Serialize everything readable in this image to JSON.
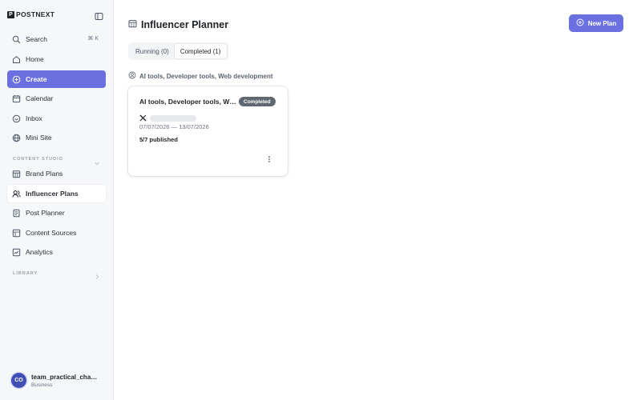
{
  "brand": {
    "mark": "P",
    "name": "POSTNEXT"
  },
  "sidebar": {
    "search": {
      "label": "Search",
      "shortcut": "⌘ K"
    },
    "main_items": [
      {
        "label": "Home",
        "icon": "home-icon"
      },
      {
        "label": "Create",
        "icon": "plus-circle-icon"
      },
      {
        "label": "Calendar",
        "icon": "calendar-icon"
      },
      {
        "label": "Inbox",
        "icon": "inbox-icon"
      },
      {
        "label": "Mini Site",
        "icon": "globe-icon"
      }
    ],
    "content_studio_label": "CONTENT STUDIO",
    "content_studio_items": [
      {
        "label": "Brand Plans",
        "icon": "calendar-grid-icon"
      },
      {
        "label": "Influencer Plans",
        "icon": "users-icon"
      },
      {
        "label": "Post Planner",
        "icon": "document-icon"
      },
      {
        "label": "Content Sources",
        "icon": "layers-icon"
      },
      {
        "label": "Analytics",
        "icon": "chart-icon"
      }
    ],
    "library_label": "LIBRARY",
    "active_item": "Influencer Plans"
  },
  "user": {
    "initials": "CO",
    "name": "team_practical_chaudhary",
    "plan": "Business"
  },
  "page": {
    "title": "Influencer Planner",
    "new_plan_label": "New Plan",
    "tabs": [
      {
        "label": "Running (0)",
        "active": false
      },
      {
        "label": "Completed (1)",
        "active": true
      }
    ],
    "topic": "AI tools, Developer tools, Web development"
  },
  "card": {
    "title": "AI tools, Developer tools, Web development",
    "status": "Completed",
    "dates": "07/07/2026 — 13/07/2026",
    "published": "5/7 published"
  },
  "colors": {
    "accent": "#6a70e0",
    "badge": "#5f6770",
    "sidebar_bg": "#f6f7f9"
  }
}
